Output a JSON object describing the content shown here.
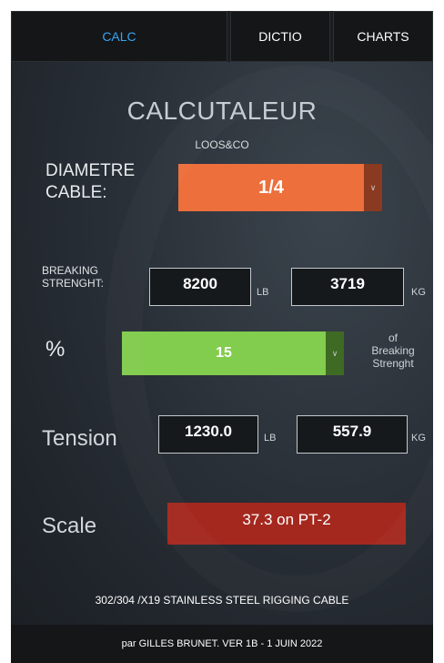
{
  "tabs": [
    {
      "label": "CALC",
      "active": true
    },
    {
      "label": "DICTIO",
      "active": false
    },
    {
      "label": "CHARTS",
      "active": false
    }
  ],
  "header": {
    "title": "CALCUTALEUR",
    "subtitle": "LOOS&CO"
  },
  "diameter": {
    "label_line1": "DIAMETRE",
    "label_line2": "CABLE:",
    "selected": "1/4"
  },
  "breaking": {
    "label_line1": "BREAKING",
    "label_line2": "STRENGHT:",
    "lb_value": "8200",
    "lb_unit": "LB",
    "kg_value": "3719",
    "kg_unit": "KG"
  },
  "percent": {
    "label": "%",
    "selected": "15",
    "note_line1": "of",
    "note_line2": "Breaking",
    "note_line3": "Strenght"
  },
  "tension": {
    "label": "Tension",
    "lb_value": "1230.0",
    "lb_unit": "LB",
    "kg_value": "557.9",
    "kg_unit": "KG"
  },
  "scale": {
    "label": "Scale",
    "value": "37.3 on PT-2"
  },
  "cable_type": "302/304 /X19 STAINLESS STEEL RIGGING CABLE",
  "footer": {
    "credit": "par GILLES BRUNET. VER 1B -  1 JUIN  2022"
  },
  "colors": {
    "accent_tab": "#34a6f0",
    "diameter_select": "#ec6f3c",
    "percent_select": "#82cc4e",
    "scale_box": "#a4281e"
  },
  "icons": {
    "dropdown": "chevron-down-icon"
  }
}
